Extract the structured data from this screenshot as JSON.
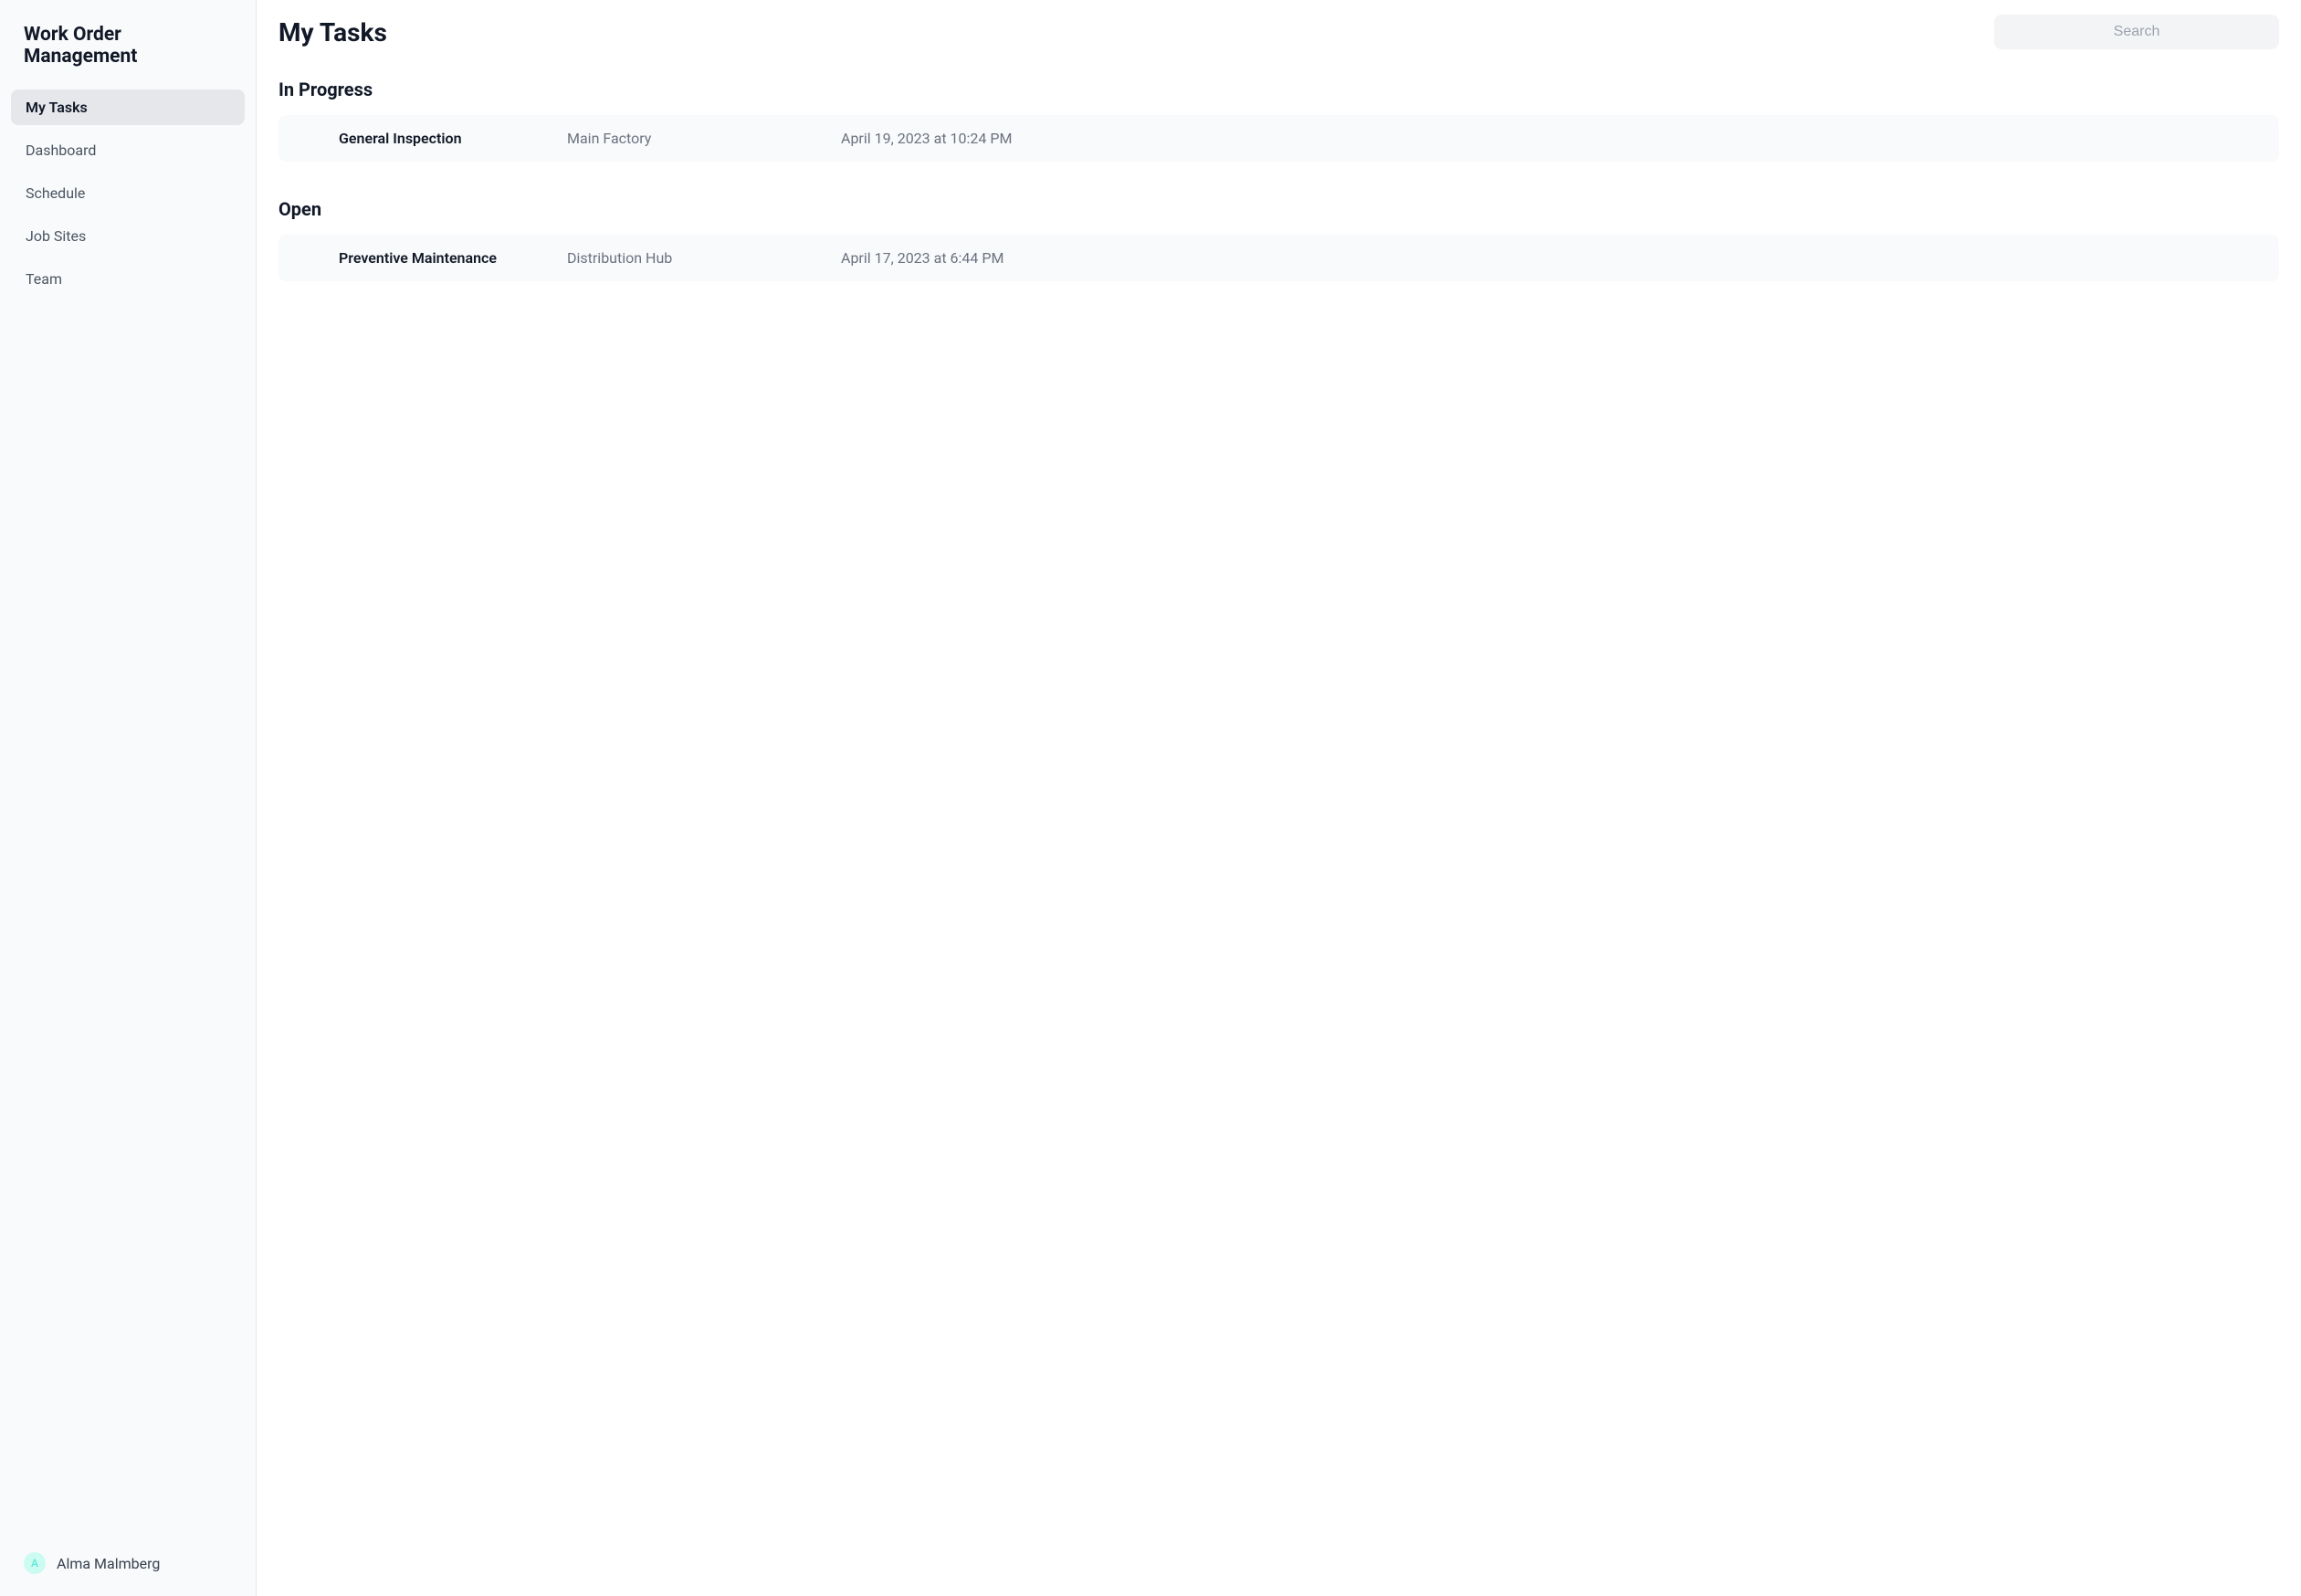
{
  "sidebar": {
    "title": "Work Order Management",
    "items": [
      {
        "label": "My Tasks",
        "active": true
      },
      {
        "label": "Dashboard",
        "active": false
      },
      {
        "label": "Schedule",
        "active": false
      },
      {
        "label": "Job Sites",
        "active": false
      },
      {
        "label": "Team",
        "active": false
      }
    ],
    "user": {
      "initial": "A",
      "name": "Alma Malmberg"
    }
  },
  "header": {
    "title": "My Tasks",
    "search_placeholder": "Search"
  },
  "sections": [
    {
      "title": "In Progress",
      "tasks": [
        {
          "name": "General Inspection",
          "location": "Main Factory",
          "datetime": "April 19, 2023 at 10:24 PM"
        }
      ]
    },
    {
      "title": "Open",
      "tasks": [
        {
          "name": "Preventive Maintenance",
          "location": "Distribution Hub",
          "datetime": "April 17, 2023 at 6:44 PM"
        }
      ]
    }
  ]
}
